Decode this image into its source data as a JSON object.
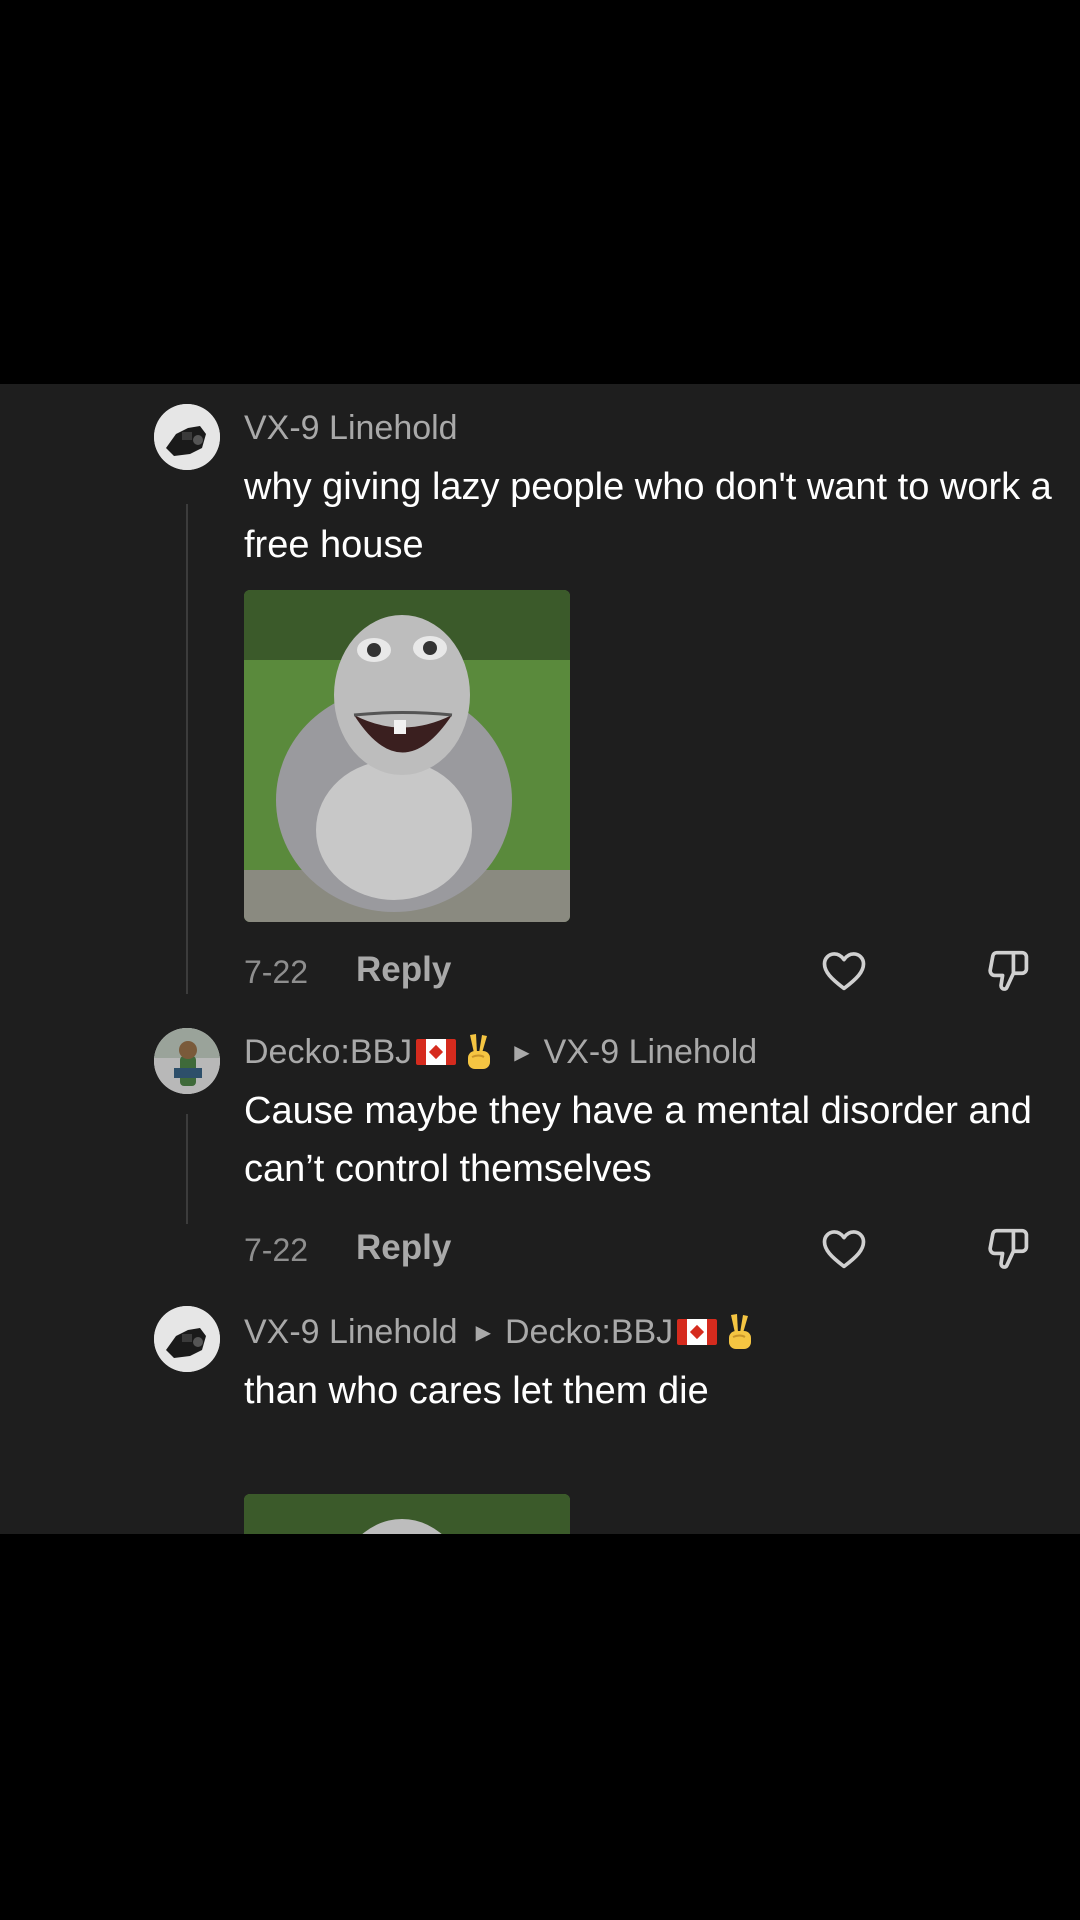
{
  "comments": [
    {
      "username": "VX-9 Linehold",
      "text": "why giving lazy people who don't want to work a free house",
      "date": "7-22",
      "reply_label": "Reply"
    },
    {
      "username": "Decko:BBJ",
      "badge_emoji": "✌",
      "reply_to": "VX-9 Linehold",
      "text": "Cause maybe they have a mental disorder and can’t control themselves",
      "date": "7-22",
      "reply_label": "Reply"
    },
    {
      "username": "VX-9 Linehold",
      "reply_to": "Decko:BBJ",
      "reply_to_badge_emoji": "✌",
      "text": "than who cares let them die"
    }
  ],
  "icons": {
    "like": "heart-outline-icon",
    "dislike": "thumbs-down-outline-icon",
    "reply_arrow": "triangle-right-icon",
    "flag": "canada-flag-icon"
  },
  "colors": {
    "background": "#000000",
    "panel": "#1e1e1e",
    "username": "#a9a9a9",
    "text": "#ffffff",
    "meta": "#8e8e8e"
  }
}
